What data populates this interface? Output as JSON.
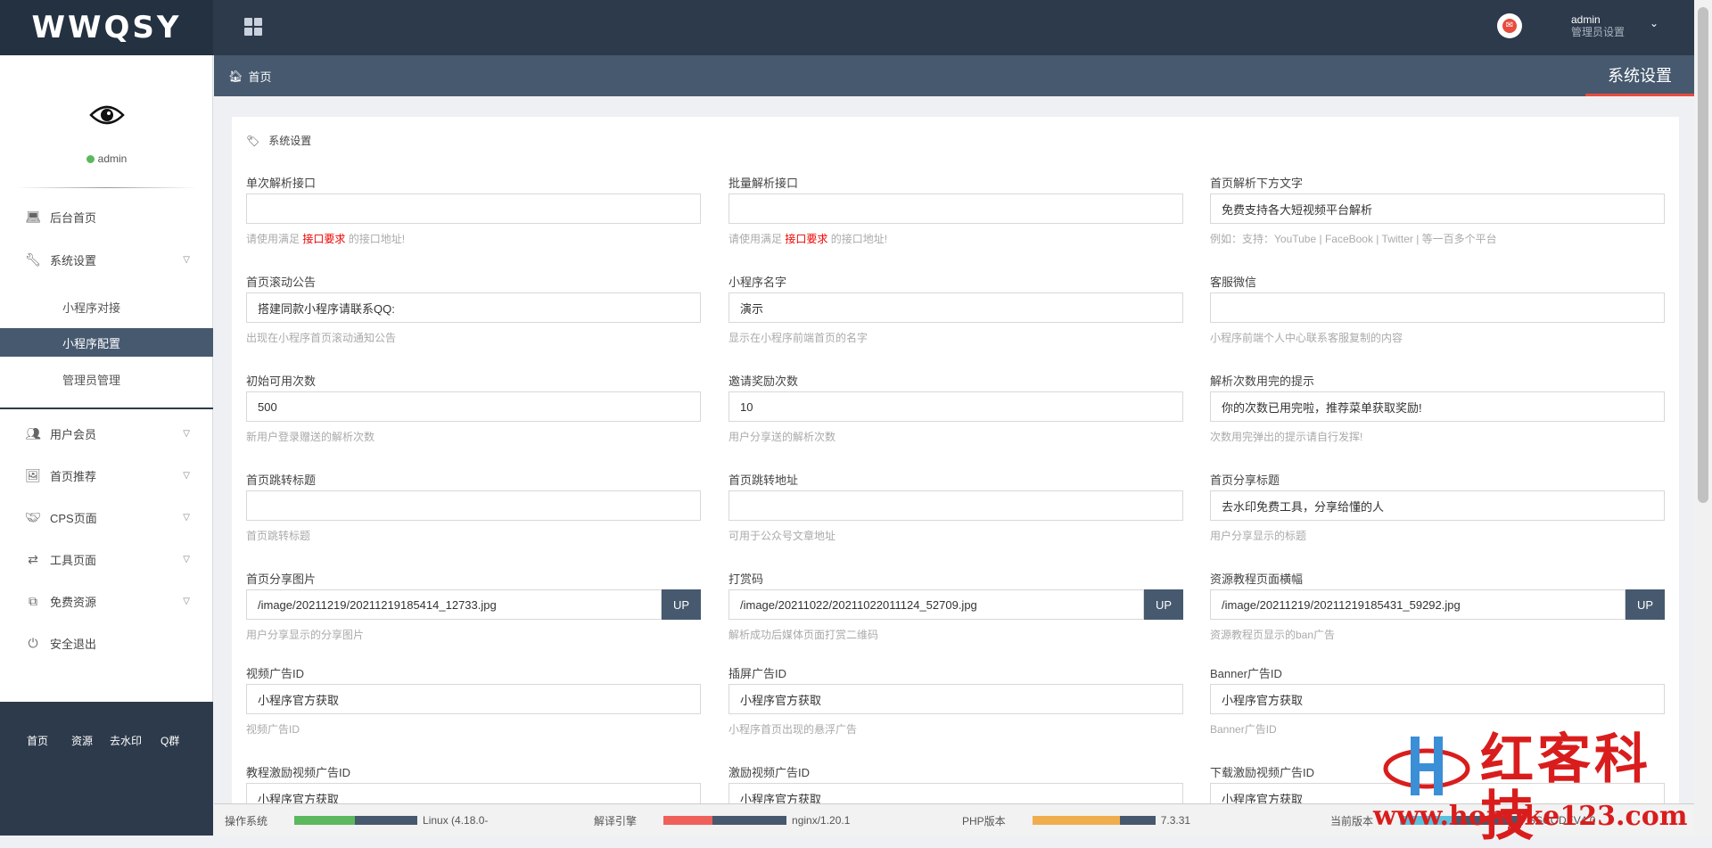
{
  "brand": {
    "logo_text": "WWQSY"
  },
  "topbar": {
    "user_name": "admin",
    "user_role": "管理员设置"
  },
  "sidebar": {
    "user": "admin",
    "items": [
      {
        "label": "后台首页",
        "icon": "laptop-icon"
      },
      {
        "label": "系统设置",
        "icon": "wrench-icon"
      },
      {
        "label": "用户会员",
        "icon": "users-icon"
      },
      {
        "label": "首页推荐",
        "icon": "image-icon"
      },
      {
        "label": "CPS页面",
        "icon": "handshake-icon"
      },
      {
        "label": "工具页面",
        "icon": "shuffle-icon"
      },
      {
        "label": "免费资源",
        "icon": "copy-icon"
      },
      {
        "label": "安全退出",
        "icon": "power-icon"
      }
    ],
    "sub_items": [
      {
        "label": "小程序对接"
      },
      {
        "label": "小程序配置",
        "active": true
      },
      {
        "label": "管理员管理"
      }
    ],
    "footer_links": [
      "首页",
      "资源",
      "去水印",
      "Q群"
    ]
  },
  "breadcrumb": {
    "home": "首页"
  },
  "page_tab": "系统设置",
  "panel": {
    "title": "系统设置"
  },
  "form": {
    "single_api": {
      "label": "单次解析接口",
      "value": "",
      "help_pre": "请使用满足 ",
      "help_link": "接口要求",
      "help_post": " 的接口地址!"
    },
    "batch_api": {
      "label": "批量解析接口",
      "value": "",
      "help_pre": "请使用满足 ",
      "help_link": "接口要求",
      "help_post": " 的接口地址!"
    },
    "home_text": {
      "label": "首页解析下方文字",
      "value": "免费支持各大短视频平台解析",
      "help": "例如：支持：YouTube | FaceBook | Twitter | 等一百多个平台"
    },
    "scroll_notice": {
      "label": "首页滚动公告",
      "value": "搭建同款小程序请联系QQ:",
      "help": "出现在小程序首页滚动通知公告"
    },
    "mini_name": {
      "label": "小程序名字",
      "value": "演示",
      "help": "显示在小程序前端首页的名字"
    },
    "service_wechat": {
      "label": "客服微信",
      "value": "",
      "help": "小程序前端个人中心联系客服复制的内容"
    },
    "init_count": {
      "label": "初始可用次数",
      "value": "500",
      "help": "新用户登录赠送的解析次数"
    },
    "invite_reward": {
      "label": "邀请奖励次数",
      "value": "10",
      "help": "用户分享送的解析次数"
    },
    "used_up_tip": {
      "label": "解析次数用完的提示",
      "value": "你的次数已用完啦，推荐菜单获取奖励!",
      "help": "次数用完弹出的提示请自行发挥!"
    },
    "jump_title": {
      "label": "首页跳转标题",
      "value": "",
      "help": "首页跳转标题"
    },
    "jump_url": {
      "label": "首页跳转地址",
      "value": "",
      "help": "可用于公众号文章地址"
    },
    "share_title": {
      "label": "首页分享标题",
      "value": "去水印免费工具，分享给懂的人",
      "help": "用户分享显示的标题"
    },
    "share_image": {
      "label": "首页分享图片",
      "value": "/image/20211219/20211219185414_12733.jpg",
      "help": "用户分享显示的分享图片",
      "button": "UP"
    },
    "reward_code": {
      "label": "打赏码",
      "value": "/image/20211022/20211022011124_52709.jpg",
      "help": "解析成功后媒体页面打赏二维码",
      "button": "UP"
    },
    "tutorial_banner": {
      "label": "资源教程页面横幅",
      "value": "/image/20211219/20211219185431_59292.jpg",
      "help": "资源教程页显示的ban广告",
      "button": "UP"
    },
    "video_ad": {
      "label": "视频广告ID",
      "value": "小程序官方获取",
      "help": "视频广告ID"
    },
    "interstitial_ad": {
      "label": "插屏广告ID",
      "value": "小程序官方获取",
      "help": "小程序首页出现的悬浮广告"
    },
    "banner_ad": {
      "label": "Banner广告ID",
      "value": "小程序官方获取",
      "help": "Banner广告ID"
    },
    "tutorial_reward_ad": {
      "label": "教程激励视频广告ID",
      "value": "小程序官方获取"
    },
    "reward_video_ad": {
      "label": "激励视频广告ID",
      "value": "小程序官方获取"
    },
    "download_reward_ad": {
      "label": "下载激励视频广告ID",
      "value": "小程序官方获取"
    }
  },
  "status": {
    "os_label": "操作系统",
    "os_value": "Linux (4.18.0-",
    "engine_label": "解译引擎",
    "engine_value": "nginx/1.20.1",
    "php_label": "PHP版本",
    "php_value": "7.3.31",
    "version_label": "当前版本",
    "version_value": "SSCODEV4.0"
  },
  "watermark": {
    "text": "红客科技",
    "url": "www.hongke123.com"
  },
  "colors": {
    "sidebar_dark": "#2d3a4b",
    "accent": "#46596f",
    "tab_underline": "#e74c3c"
  }
}
